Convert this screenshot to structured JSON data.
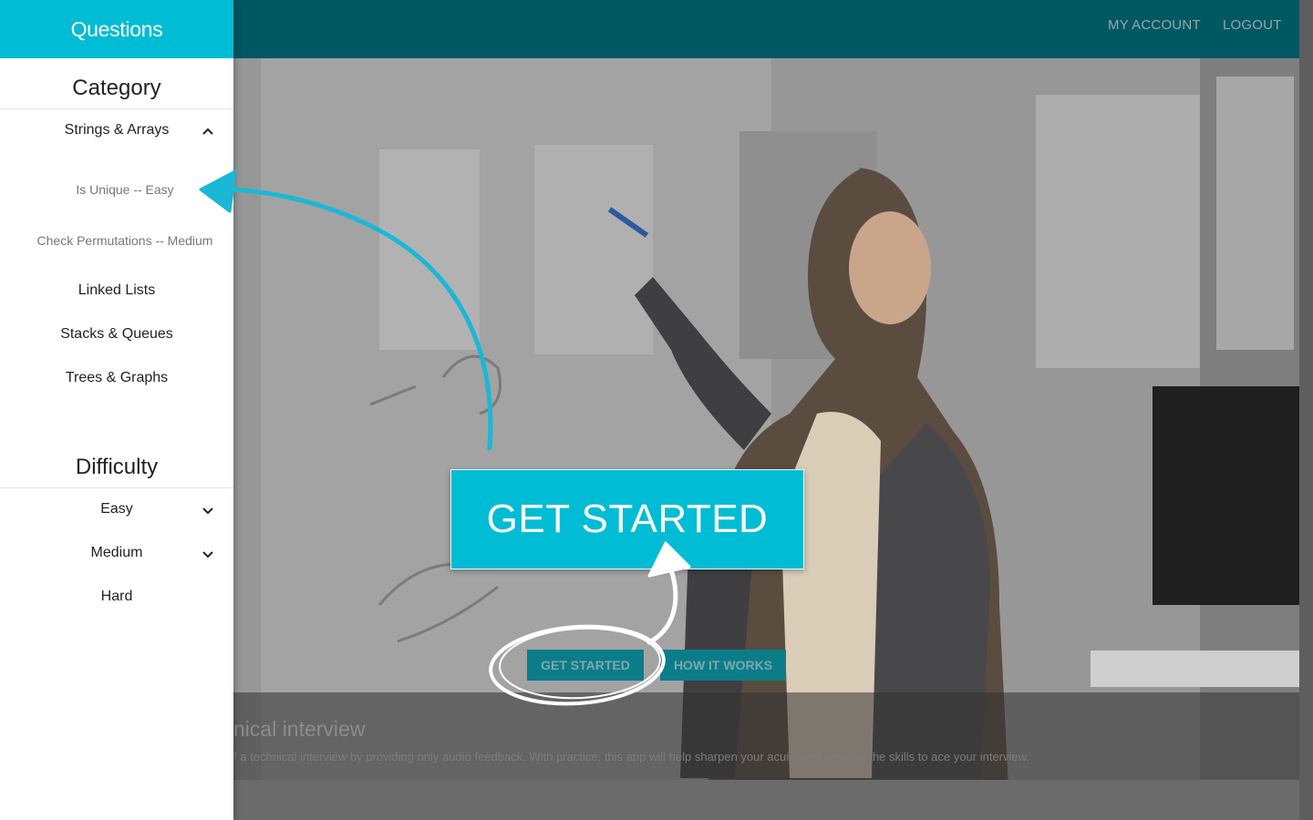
{
  "sidebar": {
    "title": "Questions",
    "category_heading": "Category",
    "categories": [
      {
        "label": "Strings & Arrays",
        "expanded": true,
        "questions": [
          "Is Unique -- Easy",
          "Check Permutations -- Medium"
        ]
      },
      {
        "label": "Linked Lists"
      },
      {
        "label": "Stacks & Queues"
      },
      {
        "label": "Trees & Graphs"
      }
    ],
    "difficulty_heading": "Difficulty",
    "difficulties": [
      {
        "label": "Easy",
        "icon": "chevron-down-icon"
      },
      {
        "label": "Medium",
        "icon": "chevron-down-icon"
      },
      {
        "label": "Hard"
      }
    ]
  },
  "topnav": {
    "my_account": "MY ACCOUNT",
    "logout": "LOGOUT"
  },
  "hero": {
    "get_started": "GET STARTED",
    "how_it_works": "HOW IT WORKS",
    "caption_title": "nical interview",
    "caption_text": "f a technical interview by providing only audio feedback. With practice, this app will help sharpen your acuity and develop the skills to ace your interview."
  },
  "callout": {
    "big_button": "GET STARTED"
  },
  "colors": {
    "accent": "#00bcd4",
    "topbar": "#005862",
    "button_teal": "#0b7d88",
    "arrow_blue": "#1ab8d6"
  }
}
